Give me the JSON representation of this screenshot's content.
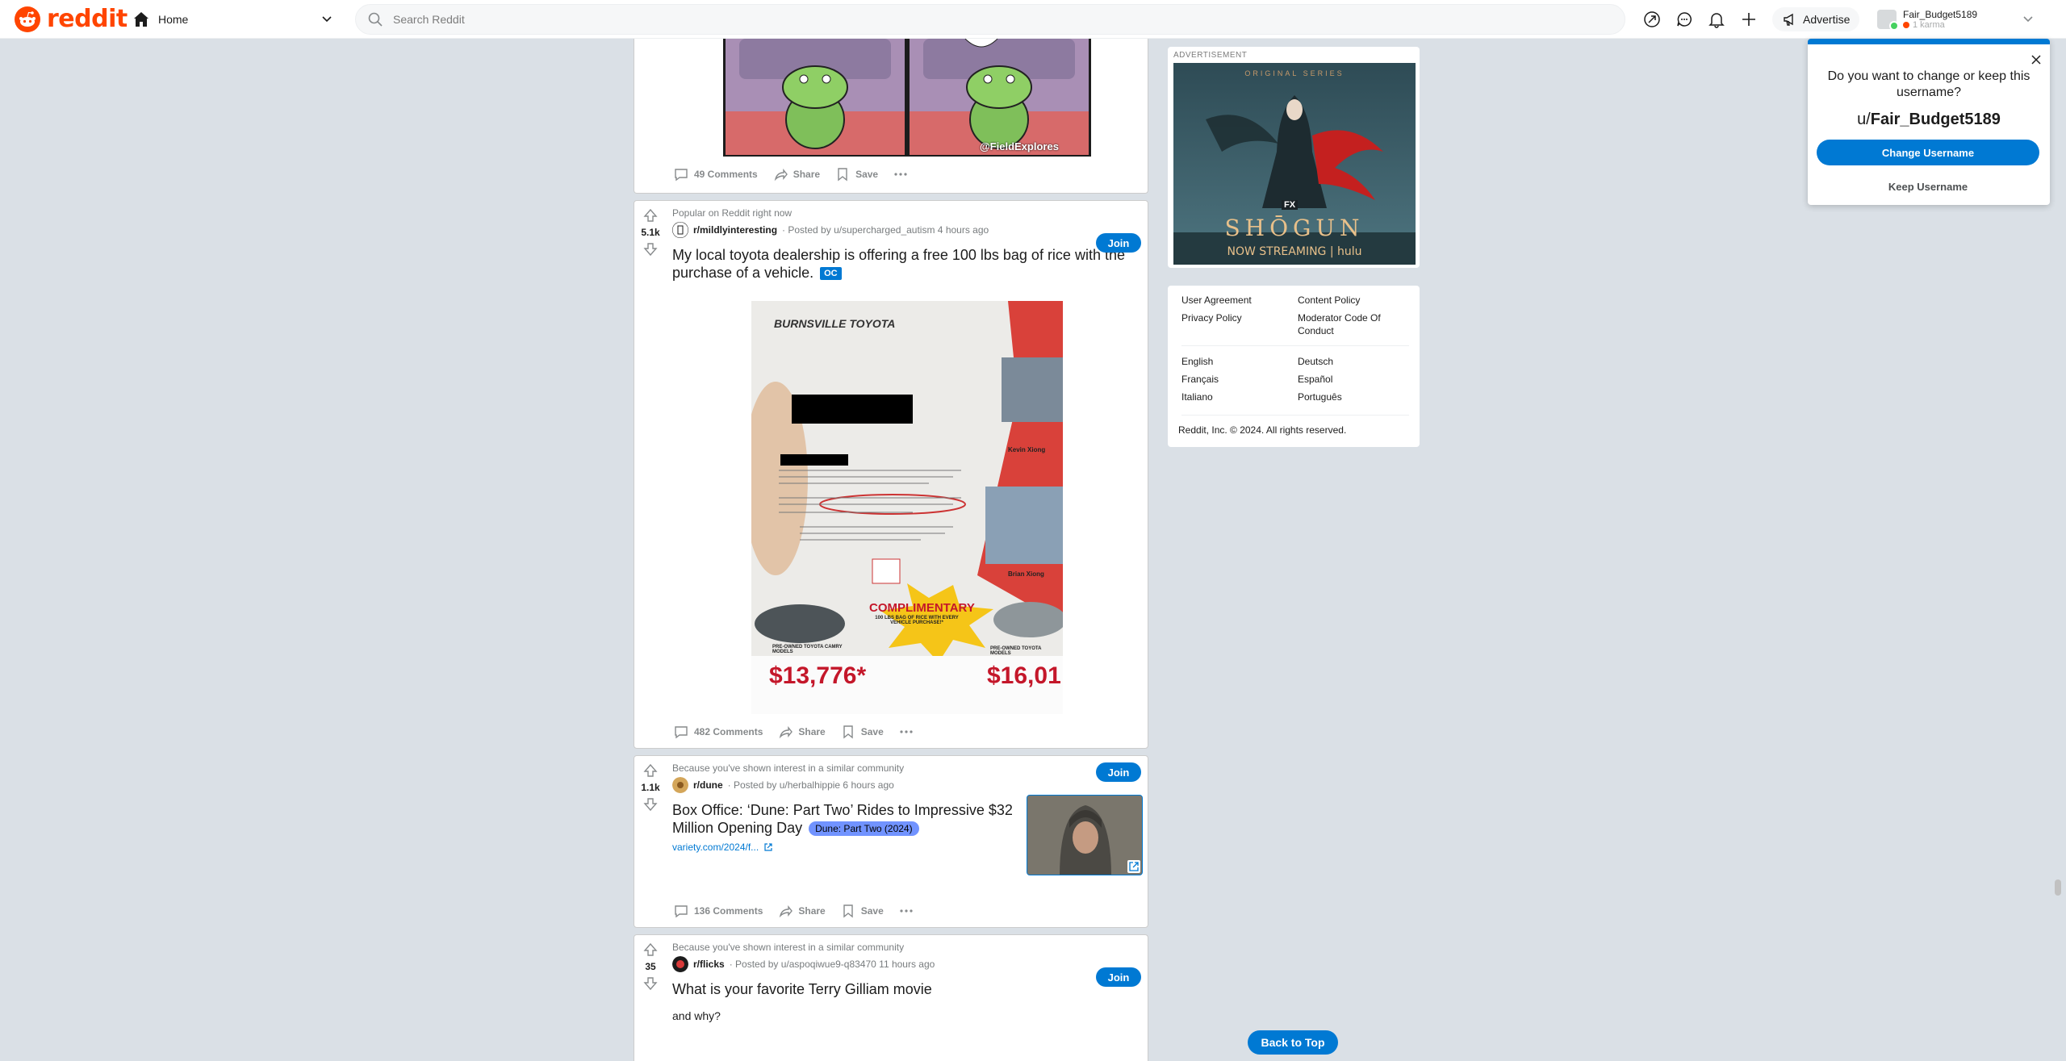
{
  "header": {
    "logo_text": "reddit",
    "home_label": "Home",
    "search_placeholder": "Search Reddit",
    "advertise_label": "Advertise",
    "username": "Fair_Budget5189",
    "karma": "1 karma",
    "icons": [
      "popular-icon",
      "chat-icon",
      "notification-icon",
      "create-post-icon"
    ]
  },
  "posts": [
    {
      "comments": "49 Comments",
      "share": "Share",
      "save": "Save",
      "image_caption": "@FieldExplores"
    },
    {
      "reason": "Popular on Reddit right now",
      "votes": "5.1k",
      "subreddit": "r/mildlyinteresting",
      "meta": "· Posted by u/supercharged_autism 4 hours ago",
      "join": "Join",
      "title": "My local toyota dealership is offering a free 100 lbs bag of rice with the purchase of a vehicle.",
      "flair": "OC",
      "image": {
        "dealer": "BURNSVILLE TOYOTA",
        "promo_title": "COMPLIMENTARY",
        "promo_text": "100 LBS BAG OF RICE WITH EVERY VEHICLE PURCHASE!*",
        "price_left": "$13,776*",
        "price_right": "$16,01",
        "left_label": "PRE-OWNED TOYOTA CAMRY MODELS",
        "right_label": "PRE-OWNED TOYOTA MODELS",
        "staff1": "Kevin Xiong",
        "staff2": "Brian Xiong"
      },
      "comments": "482 Comments",
      "share": "Share",
      "save": "Save"
    },
    {
      "reason": "Because you've shown interest in a similar community",
      "votes": "1.1k",
      "subreddit": "r/dune",
      "meta": "· Posted by u/herbalhippie 6 hours ago",
      "join": "Join",
      "title": "Box Office: ‘Dune: Part Two’ Rides to Impressive $32 Million Opening Day",
      "flair": "Dune: Part Two (2024)",
      "link": "variety.com/2024/f...",
      "comments": "136 Comments",
      "share": "Share",
      "save": "Save"
    },
    {
      "reason": "Because you've shown interest in a similar community",
      "votes": "35",
      "subreddit": "r/flicks",
      "meta": "· Posted by u/aspoqiwue9-q83470 11 hours ago",
      "join": "Join",
      "title": "What is your favorite Terry Gilliam movie",
      "body": "and why?"
    }
  ],
  "sidebar": {
    "ad_label": "ADVERTISEMENT",
    "ad": {
      "origin": "ORIGINAL SERIES",
      "fx": "FX",
      "title": "SHŌGUN",
      "stream": "NOW STREAMING | hulu"
    },
    "links_col1": [
      "User Agreement",
      "Privacy Policy"
    ],
    "links_col2": [
      "Content Policy",
      "Moderator Code Of Conduct"
    ],
    "lang_col1": [
      "English",
      "Français",
      "Italiano"
    ],
    "lang_col2": [
      "Deutsch",
      "Español",
      "Português"
    ],
    "copyright": "Reddit, Inc. © 2024. All rights reserved."
  },
  "popup": {
    "question": "Do you want to change or keep this username?",
    "prefix": "u/",
    "username": "Fair_Budget5189",
    "change_label": "Change Username",
    "keep_label": "Keep Username"
  },
  "back_to_top": "Back to Top",
  "colors": {
    "brand": "#ff4500",
    "accent": "#0079d3",
    "background": "#dae0e6"
  }
}
